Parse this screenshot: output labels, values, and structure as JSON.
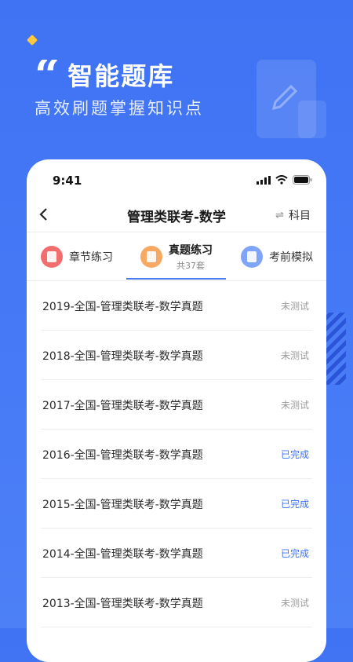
{
  "hero": {
    "title": "智能题库",
    "subtitle": "高效刷题掌握知识点",
    "quote_glyph": "“"
  },
  "status_bar": {
    "time": "9:41"
  },
  "nav": {
    "title": "管理类联考-数学",
    "subject_label": "科目",
    "swap_glyph": "⇌"
  },
  "tabs": [
    {
      "label": "章节练习",
      "sub": "",
      "icon": "chapter-icon",
      "color": "#f06a6a"
    },
    {
      "label": "真题练习",
      "sub": "共37套",
      "icon": "paper-icon",
      "color": "#f6a85f",
      "active": true
    },
    {
      "label": "考前模拟",
      "sub": "",
      "icon": "mock-icon",
      "color": "#7aa2f7"
    }
  ],
  "papers": [
    {
      "title": "2019-全国-管理类联考-数学真题",
      "status": "未测试",
      "done": false
    },
    {
      "title": "2018-全国-管理类联考-数学真题",
      "status": "未测试",
      "done": false
    },
    {
      "title": "2017-全国-管理类联考-数学真题",
      "status": "未测试",
      "done": false
    },
    {
      "title": "2016-全国-管理类联考-数学真题",
      "status": "已完成",
      "done": true
    },
    {
      "title": "2015-全国-管理类联考-数学真题",
      "status": "已完成",
      "done": true
    },
    {
      "title": "2014-全国-管理类联考-数学真题",
      "status": "已完成",
      "done": true
    },
    {
      "title": "2013-全国-管理类联考-数学真题",
      "status": "未测试",
      "done": false
    }
  ],
  "colors": {
    "accent": "#4a7cf6",
    "background": "#4478f5",
    "done": "#3c73f2",
    "pending": "#9b9b9b"
  }
}
